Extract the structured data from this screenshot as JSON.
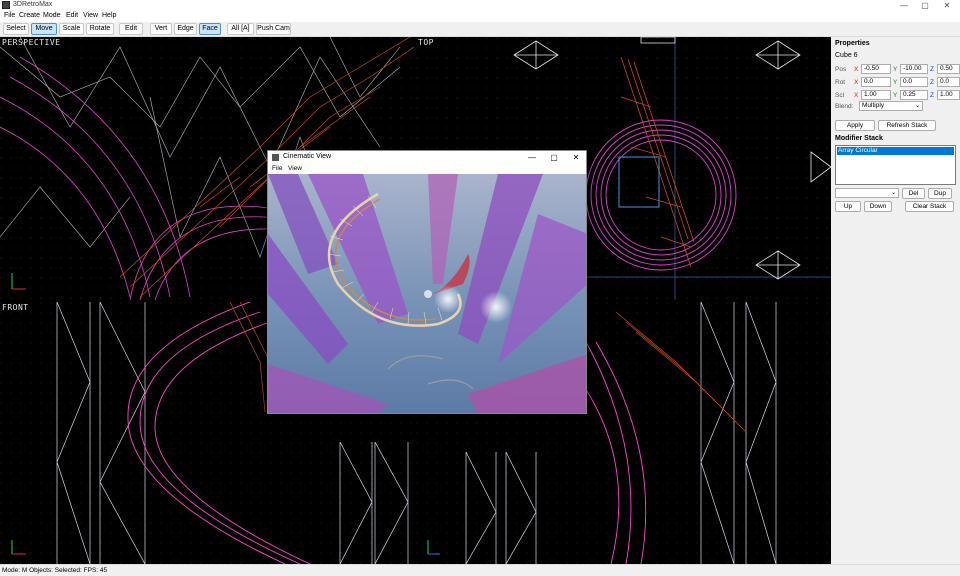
{
  "app": {
    "title": "3DRetroMax"
  },
  "window_controls": {
    "minimize": "—",
    "maximize": "▢",
    "close": "✕"
  },
  "menu": [
    "File",
    "Create",
    "Mode",
    "Edit",
    "View",
    "Help"
  ],
  "toolbar": {
    "select": "Select",
    "move": "Move",
    "scale": "Scale",
    "rotate": "Rotate",
    "edit": "Edit",
    "vert": "Vert",
    "edge": "Edge",
    "face": "Face",
    "all": "All [A]",
    "push_cam": "Push Cam"
  },
  "viewports": {
    "perspective": "PERSPECTIVE",
    "top": "TOP",
    "front": "FRONT"
  },
  "properties": {
    "heading": "Properties",
    "object_name": "Cube 6",
    "pos_label": "Pos",
    "rot_label": "Rot",
    "scl_label": "Scl",
    "x": "X",
    "y": "Y",
    "z": "Z",
    "pos": {
      "x": "-0.50",
      "y": "-10.00",
      "z": "0.50"
    },
    "rot": {
      "x": "0.0",
      "y": "0.0",
      "z": "0.0"
    },
    "scl": {
      "x": "1.00",
      "y": "0.25",
      "z": "1.00"
    },
    "blend_label": "Blend:",
    "blend_value": "Multiply",
    "apply": "Apply",
    "refresh_stack": "Refresh Stack",
    "modifier_heading": "Modifier Stack",
    "modifiers": [
      "Array Circular"
    ],
    "del": "Del",
    "dup": "Dup",
    "up": "Up",
    "down": "Down",
    "clear_stack": "Clear Stack"
  },
  "status": "Mode: M Objects:  Selected:  FPS: 45",
  "cinematic": {
    "title": "Cinematic View",
    "menu_file": "File",
    "menu_view": "View"
  },
  "colors": {
    "wire": "#e040d0",
    "wire2": "#ff44cc",
    "rust": "#c84a1c",
    "white_wire": "#d8d8e8",
    "accent": "#0078d7"
  }
}
